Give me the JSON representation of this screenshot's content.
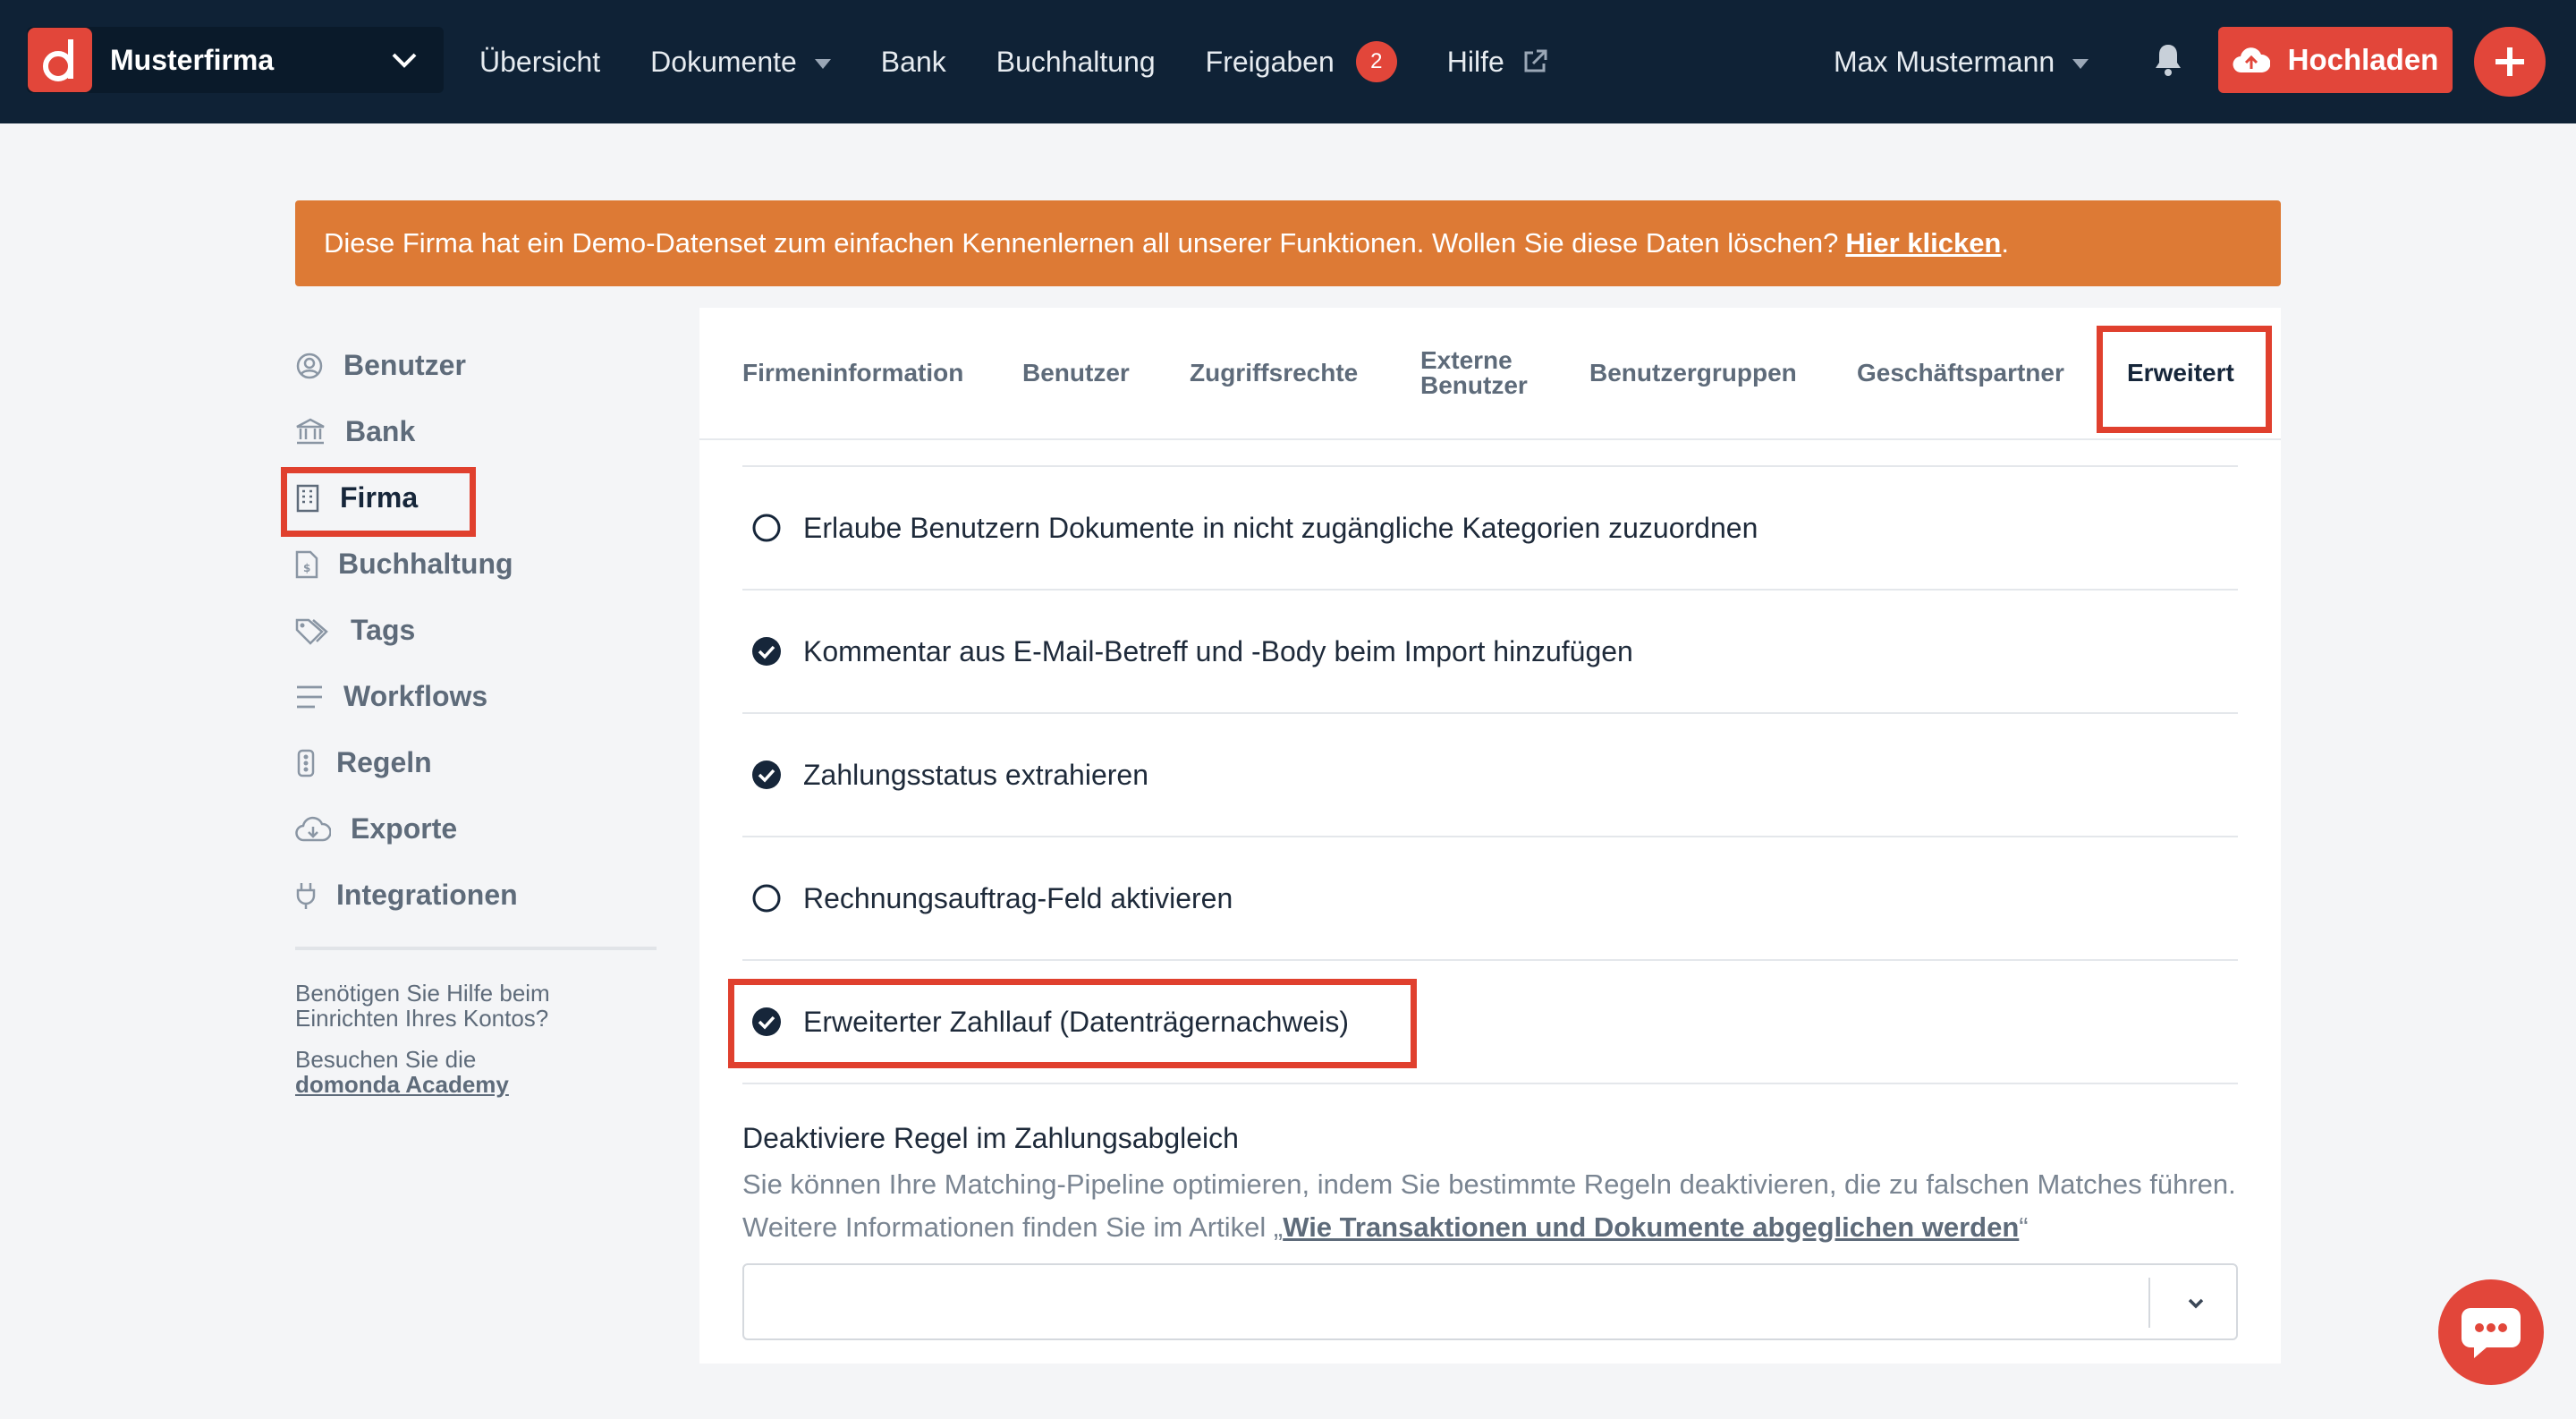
{
  "topbar": {
    "company": "Musterfirma",
    "nav": [
      {
        "label": "Übersicht"
      },
      {
        "label": "Dokumente"
      },
      {
        "label": "Bank"
      },
      {
        "label": "Buchhaltung"
      },
      {
        "label": "Freigaben",
        "badge": "2"
      },
      {
        "label": "Hilfe"
      }
    ],
    "user": "Max Mustermann",
    "upload_label": "Hochladen"
  },
  "banner": {
    "text": "Diese Firma hat ein Demo-Datenset zum einfachen Kennenlernen all unserer Funktionen. Wollen Sie diese Daten löschen?",
    "link": "Hier klicken",
    "suffix": "."
  },
  "sidebar": {
    "items": [
      {
        "label": "Benutzer",
        "icon": "user-circle-icon"
      },
      {
        "label": "Bank",
        "icon": "bank-icon"
      },
      {
        "label": "Firma",
        "icon": "building-icon",
        "active": true
      },
      {
        "label": "Buchhaltung",
        "icon": "invoice-icon"
      },
      {
        "label": "Tags",
        "icon": "tags-icon"
      },
      {
        "label": "Workflows",
        "icon": "lines-icon"
      },
      {
        "label": "Regeln",
        "icon": "traffic-light-icon"
      },
      {
        "label": "Exporte",
        "icon": "cloud-download-icon"
      },
      {
        "label": "Integrationen",
        "icon": "plug-icon"
      }
    ],
    "help_text": "Benötigen Sie Hilfe beim Einrichten Ihres Kontos?",
    "help_visit": "Besuchen Sie die",
    "help_link": "domonda Academy"
  },
  "tabs": [
    {
      "label": "Firmeninformation"
    },
    {
      "label": "Benutzer"
    },
    {
      "label": "Zugriffsrechte"
    },
    {
      "label": "Externe Benutzer"
    },
    {
      "label": "Benutzergruppen"
    },
    {
      "label": "Geschäftspartner"
    },
    {
      "label": "Erweitert",
      "active": true
    }
  ],
  "options": [
    {
      "label": "Erlaube Benutzern Dokumente in nicht zugängliche Kategorien zuzuordnen",
      "checked": false
    },
    {
      "label": "Kommentar aus E-Mail-Betreff und -Body beim Import hinzufügen",
      "checked": true
    },
    {
      "label": "Zahlungsstatus extrahieren",
      "checked": true
    },
    {
      "label": "Rechnungsauftrag-Feld aktivieren",
      "checked": false
    },
    {
      "label": "Erweiterter Zahllauf (Datenträgernachweis)",
      "checked": true
    }
  ],
  "matching": {
    "title": "Deaktiviere Regel im Zahlungsabgleich",
    "desc": "Sie können Ihre Matching-Pipeline optimieren, indem Sie bestimmte Regeln deaktivieren, die zu falschen Matches führen. Weitere Informationen finden Sie im Artikel „",
    "link": "Wie Transaktionen und Dokumente abgeglichen werden",
    "desc_suffix": "“",
    "selected": ""
  },
  "colors": {
    "accent": "#e2463a",
    "nav_bg": "#0f2236",
    "banner": "#dd7a35",
    "highlight": "#e0402e"
  }
}
